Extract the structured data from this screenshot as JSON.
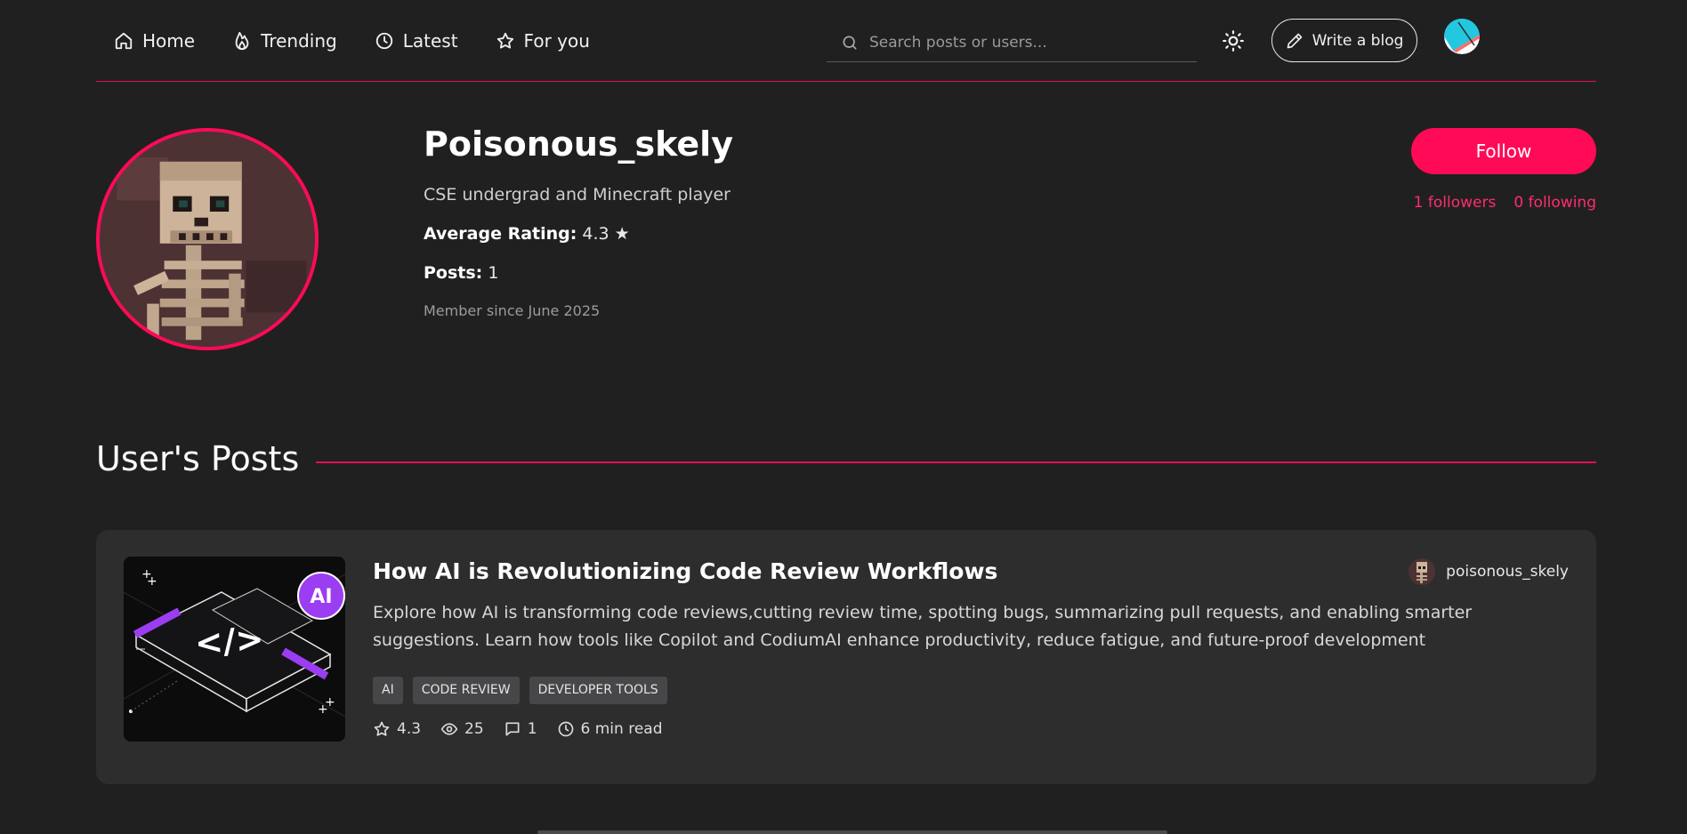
{
  "nav": {
    "items": [
      {
        "label": "Home",
        "icon": "home-icon"
      },
      {
        "label": "Trending",
        "icon": "flame-icon"
      },
      {
        "label": "Latest",
        "icon": "clock-icon"
      },
      {
        "label": "For you",
        "icon": "star-icon"
      }
    ],
    "search_placeholder": "Search posts or users...",
    "write_label": "Write a blog"
  },
  "profile": {
    "username": "Poisonous_skely",
    "bio": "CSE undergrad and Minecraft player",
    "rating_label": "Average Rating:",
    "rating_value": "4.3 ★",
    "posts_label": "Posts:",
    "posts_value": "1",
    "member_since": "Member since June 2025",
    "follow_label": "Follow",
    "followers": "1 followers",
    "following": "0 following"
  },
  "section": {
    "title": "User's Posts"
  },
  "post": {
    "title": "How AI is Revolutionizing Code Review Workflows",
    "author": "poisonous_skely",
    "description": "Explore how AI is transforming code reviews,cutting review time, spotting bugs, summarizing pull requests, and enabling smarter suggestions. Learn how tools like Copilot and CodiumAI enhance productivity, reduce fatigue, and future-proof development",
    "thumb_badge": "AI",
    "thumb_code": "</>",
    "tags": [
      "AI",
      "CODE REVIEW",
      "DEVELOPER TOOLS"
    ],
    "rating": "4.3",
    "views": "25",
    "comments": "1",
    "read_time": "6 min read"
  },
  "colors": {
    "accent": "#ff0a57",
    "background": "#202021",
    "card": "#2d2d2e"
  }
}
